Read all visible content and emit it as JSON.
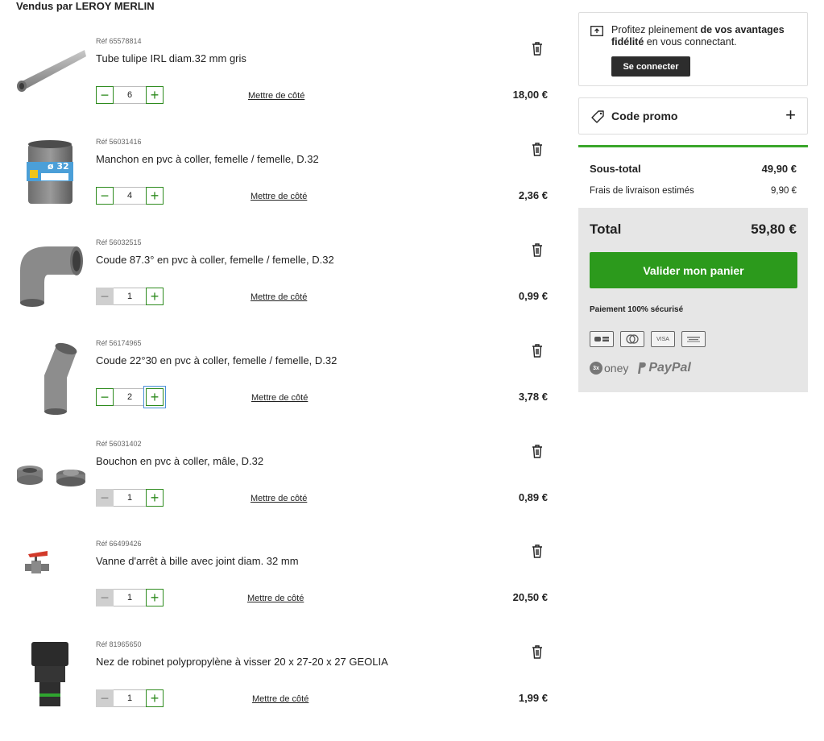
{
  "seller_heading": "Vendus par LEROY MERLIN",
  "items": [
    {
      "ref": "Réf 65578814",
      "name": "Tube tulipe IRL diam.32 mm gris",
      "qty": "6",
      "aside": "Mettre de côté",
      "price": "18,00 €",
      "minus_disabled": false
    },
    {
      "ref": "Réf 56031416",
      "name": "Manchon en pvc à coller, femelle / femelle, D.32",
      "qty": "4",
      "aside": "Mettre de côté",
      "price": "2,36 €",
      "minus_disabled": false
    },
    {
      "ref": "Réf 56032515",
      "name": "Coude 87.3° en pvc à coller, femelle / femelle, D.32",
      "qty": "1",
      "aside": "Mettre de côté",
      "price": "0,99 €",
      "minus_disabled": true
    },
    {
      "ref": "Réf 56174965",
      "name": "Coude 22°30 en pvc à coller, femelle / femelle, D.32",
      "qty": "2",
      "aside": "Mettre de côté",
      "price": "3,78 €",
      "minus_disabled": false
    },
    {
      "ref": "Réf 56031402",
      "name": "Bouchon en pvc à coller, mâle, D.32",
      "qty": "1",
      "aside": "Mettre de côté",
      "price": "0,89 €",
      "minus_disabled": true
    },
    {
      "ref": "Réf 66499426",
      "name": "Vanne d'arrêt à bille avec joint diam. 32 mm",
      "qty": "1",
      "aside": "Mettre de côté",
      "price": "20,50 €",
      "minus_disabled": true
    },
    {
      "ref": "Réf 81965650",
      "name": "Nez de robinet polypropylène à visser 20 x 27-20 x 27 GEOLIA",
      "qty": "1",
      "aside": "Mettre de côté",
      "price": "1,99 €",
      "minus_disabled": true
    }
  ],
  "login": {
    "text_prefix": "Profitez pleinement ",
    "text_bold": "de vos avantages fidélité",
    "text_suffix": " en vous connectant.",
    "button": "Se connecter"
  },
  "promo": {
    "label": "Code promo",
    "icon": "tag-icon"
  },
  "summary": {
    "subtotal_label": "Sous-total",
    "subtotal_value": "49,90 €",
    "shipping_label": "Frais de livraison estimés",
    "shipping_value": "9,90 €",
    "total_label": "Total",
    "total_value": "59,80 €",
    "validate_button": "Valider mon panier",
    "secure_label": "Paiement 100% sécurisé",
    "card_icons": [
      "cb-card-icon",
      "mastercard-icon",
      "visa-icon",
      "amex-icon"
    ],
    "visa_text": "VISA",
    "oney_badge": "3x",
    "oney_text": "oney",
    "paypal_text": "PayPal"
  },
  "colors": {
    "accent_green": "#2c9a1c",
    "focus_blue": "#4a90d9"
  }
}
